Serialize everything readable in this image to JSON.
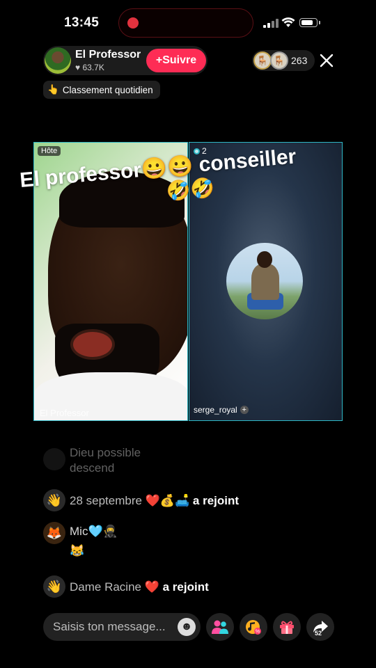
{
  "status_bar": {
    "time": "13:45",
    "battery_level": 0.8
  },
  "host": {
    "name": "El Professor",
    "likes": "63.7K",
    "follow_label": "Suivre"
  },
  "viewers": {
    "count": "263"
  },
  "ranking": {
    "label": "Classement quotidien"
  },
  "video": {
    "host_tag": "Hôte",
    "host_name": "El Professor",
    "guest_count": "2",
    "guest_name": "serge_royal",
    "overlay_line1": "El professor😀😀 conseiller",
    "overlay_line2": "🤣🤣"
  },
  "chat": [
    {
      "avatar": "",
      "text": "Dieu possible descend",
      "faded": true
    },
    {
      "avatar": "👋",
      "name": "28 septembre ❤️💰🛋️",
      "action": "a rejoint"
    },
    {
      "avatar": "🦊",
      "name": "Mic🩵🥷",
      "message": "😹"
    },
    {
      "avatar": "👋",
      "name": "Dame Racine ❤️",
      "action": "a rejoint"
    }
  ],
  "composer": {
    "placeholder": "Saisis ton message...",
    "share_count": "52"
  }
}
